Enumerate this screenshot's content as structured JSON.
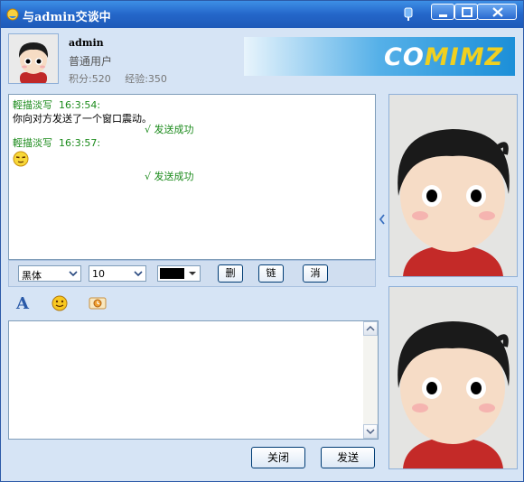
{
  "window": {
    "title": "与admin交谈中",
    "controls": {
      "minimize": "minimize-icon",
      "maximize": "maximize-icon",
      "close": "close-icon"
    }
  },
  "contact": {
    "name": "admin",
    "role": "普通用户",
    "points": "积分:520",
    "experience": "经验:350",
    "avatar_icon": "cartoon-boy-avatar"
  },
  "banner": {
    "logo_prefix": "CO",
    "logo_highlight": "MIMZ",
    "logo_text": "COMIMZ"
  },
  "chat": {
    "messages": [
      {
        "sender": "輕描淡写",
        "time": "16:3:54:",
        "text": "你向对方发送了一个窗口震动。",
        "status": "√ 发送成功"
      },
      {
        "sender": "輕描淡写",
        "time": "16:3:57:",
        "emoticon": "smug-face-emoji",
        "status": "√ 发送成功"
      }
    ]
  },
  "format_toolbar": {
    "font_family": "黑体",
    "font_size": "10",
    "color": "#000000",
    "buttons": {
      "delete": "删",
      "link": "链",
      "cancel": "消"
    }
  },
  "emote_toolbar": {
    "icons": [
      "font-icon",
      "emoticon-icon",
      "shake-window-icon"
    ]
  },
  "input": {
    "value": "",
    "placeholder": ""
  },
  "actions": {
    "close": "关闭",
    "send": "发送"
  },
  "photos": {
    "contact_photo": "cartoon-boy-photo",
    "self_photo": "cartoon-boy-photo"
  },
  "colors": {
    "titlebar": "#2466c9",
    "window_bg": "#d6e4f5",
    "message_header": "#1a8a1a"
  }
}
